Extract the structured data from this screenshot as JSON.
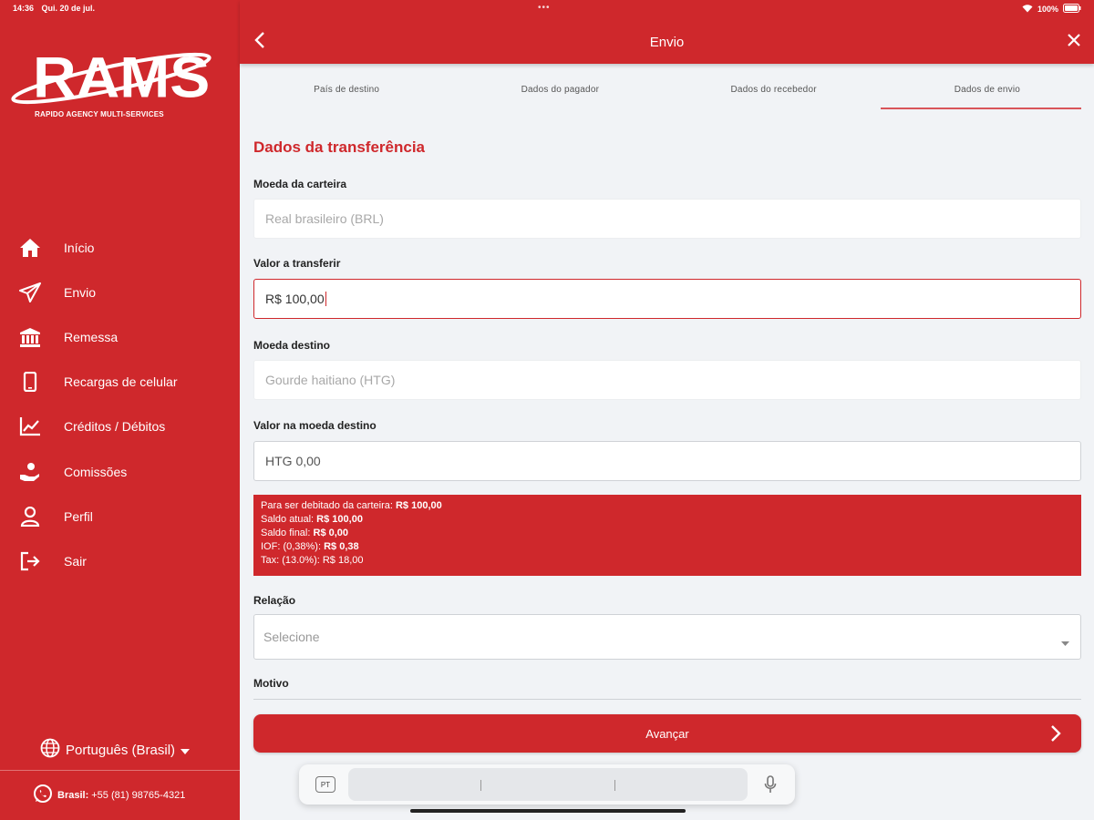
{
  "status_bar": {
    "time": "14:36",
    "date": "Qui. 20 de jul.",
    "battery": "100%"
  },
  "logo": {
    "text": "RAMS",
    "tagline": "RAPIDO AGENCY MULTI-SERVICES"
  },
  "sidebar": {
    "items": [
      {
        "label": "Início",
        "icon": "home-icon"
      },
      {
        "label": "Envio",
        "icon": "send-icon"
      },
      {
        "label": "Remessa",
        "icon": "bank-icon"
      },
      {
        "label": "Recargas de celular",
        "icon": "phone-icon"
      },
      {
        "label": "Créditos / Débitos",
        "icon": "chart-icon"
      },
      {
        "label": "Comissões",
        "icon": "hand-coin-icon"
      },
      {
        "label": "Perfil",
        "icon": "user-icon"
      },
      {
        "label": "Sair",
        "icon": "logout-icon"
      }
    ],
    "language": "Português (Brasil)",
    "contact": {
      "label": "Brasil:",
      "number": "+55 (81) 98765-4321"
    }
  },
  "header": {
    "title": "Envio"
  },
  "tabs": [
    {
      "label": "País de destino",
      "active": false
    },
    {
      "label": "Dados do pagador",
      "active": false
    },
    {
      "label": "Dados do recebedor",
      "active": false
    },
    {
      "label": "Dados de envio",
      "active": true
    }
  ],
  "form": {
    "section_title": "Dados da transferência",
    "wallet_currency": {
      "label": "Moeda da carteira",
      "value": "Real brasileiro (BRL)"
    },
    "amount": {
      "label": "Valor a transferir",
      "value": "R$ 100,00"
    },
    "dest_currency": {
      "label": "Moeda destino",
      "value": "Gourde haitiano (HTG)"
    },
    "dest_amount": {
      "label": "Valor na moeda destino",
      "value": "HTG 0,00"
    },
    "summary": {
      "debit_label": "Para ser debitado da carteira:",
      "debit_value": "R$ 100,00",
      "balance_label": "Saldo atual:",
      "balance_value": "R$ 100,00",
      "final_label": "Saldo final:",
      "final_value": "R$ 0,00",
      "iof_label": "IOF: (0,38%):",
      "iof_value": "R$ 0,38",
      "tax_text": "Tax: (13.0%): R$ 18,00"
    },
    "relation": {
      "label": "Relação",
      "placeholder": "Selecione"
    },
    "reason": {
      "label": "Motivo"
    },
    "submit_label": "Avançar"
  },
  "keyboard": {
    "lang": "PT"
  },
  "colors": {
    "brand": "#cf282c",
    "background": "#f1f3f6"
  }
}
